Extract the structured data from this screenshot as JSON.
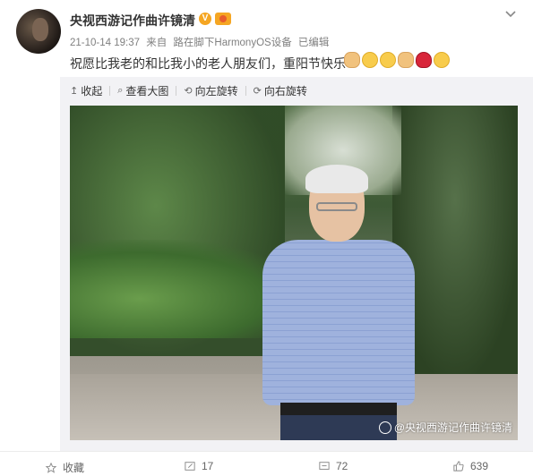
{
  "post": {
    "username": "央视西游记作曲许镜清",
    "verified_badge": "V",
    "meta": {
      "time": "21-10-14 19:37",
      "source_prefix": "来自",
      "source": "路在脚下HarmonyOS设备",
      "edited": "已编辑"
    },
    "text": "祝愿比我老的和比我小的老人朋友们，重阳节快乐",
    "emojis": [
      "victory-hand-emoji",
      "blush-emoji",
      "blush-emoji",
      "flex-arm-emoji",
      "rose-emoji",
      "smile-emoji"
    ]
  },
  "media_toolbar": {
    "collapse": "收起",
    "view_large": "查看大图",
    "rotate_left": "向左旋转",
    "rotate_right": "向右旋转"
  },
  "photo": {
    "watermark": "@央视西游记作曲许镜清"
  },
  "actions": {
    "favorite": "收藏",
    "repost": "17",
    "comment": "72",
    "like": "639"
  },
  "colors": {
    "accent": "#f5a623",
    "text": "#333333",
    "meta": "#808080",
    "media_bg": "#f2f2f5"
  }
}
